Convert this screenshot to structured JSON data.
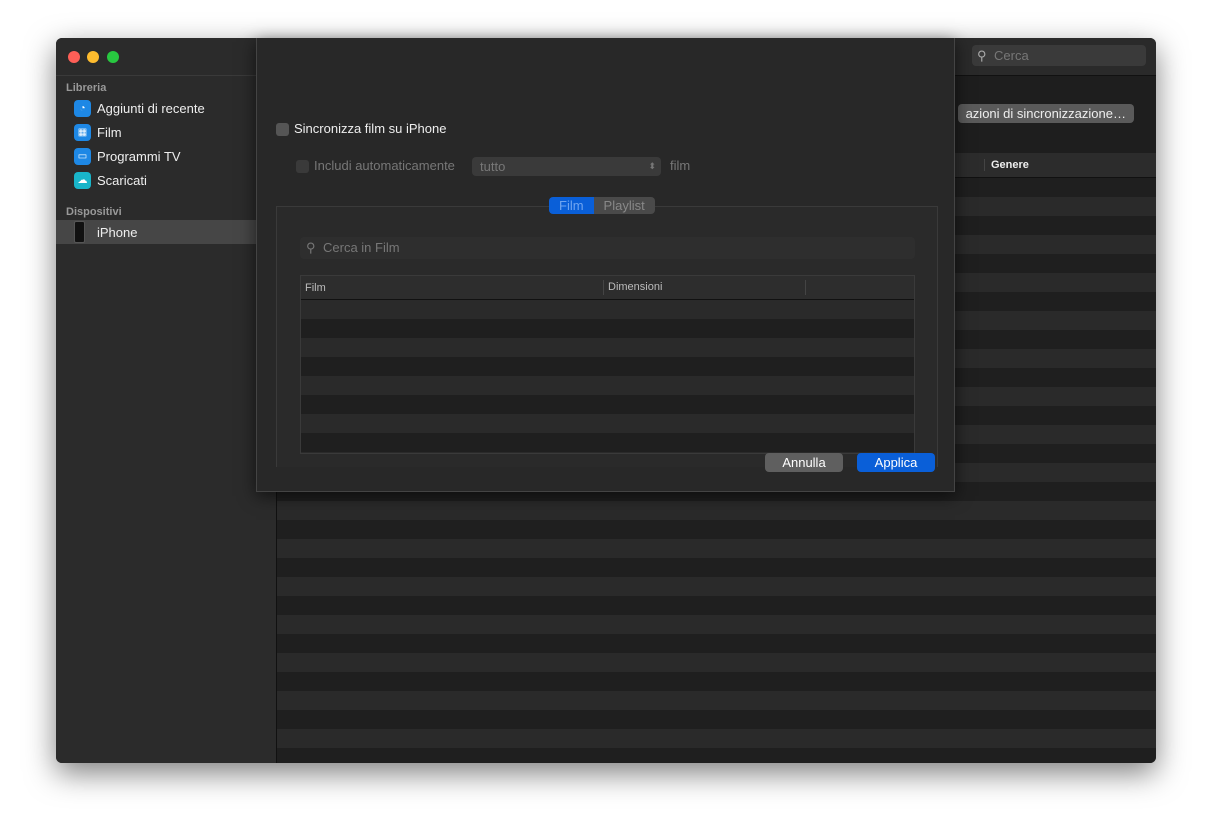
{
  "sidebar": {
    "library_title": "Libreria",
    "items": [
      {
        "label": "Aggiunti di recente",
        "icon": "clock-icon"
      },
      {
        "label": "Film",
        "icon": "film-icon"
      },
      {
        "label": "Programmi TV",
        "icon": "tv-icon"
      },
      {
        "label": "Scaricati",
        "icon": "download-icon"
      }
    ],
    "devices_title": "Dispositivi",
    "device": "iPhone"
  },
  "main": {
    "search_placeholder": "Cerca",
    "sync_button": "azioni di sincronizzazione…",
    "column_genre": "Genere"
  },
  "sheet": {
    "sync_label": "Sincronizza film su iPhone",
    "include_label": "Includi automaticamente",
    "include_value": "tutto",
    "include_suffix": "film",
    "tabs": [
      "Film",
      "Playlist"
    ],
    "search_placeholder": "Cerca in Film",
    "columns": [
      "Film",
      "Dimensioni"
    ],
    "cancel": "Annulla",
    "apply": "Applica"
  },
  "colors": {
    "accent": "#0a5fd8"
  }
}
